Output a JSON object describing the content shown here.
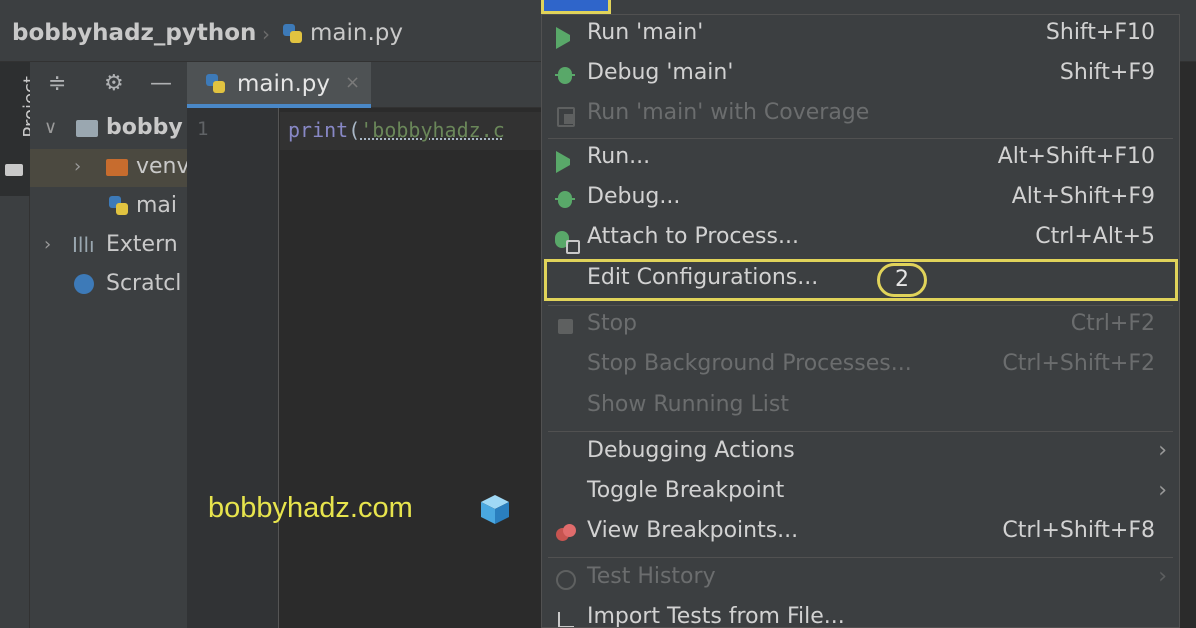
{
  "navbar": {
    "project_name": "bobbyhadz_python",
    "separator": "›",
    "file_name": "main.py"
  },
  "stripe": {
    "project_label": "Project"
  },
  "project_panel": {
    "toolbar_icons": [
      "collapse-icon",
      "gear-icon",
      "minimize-icon"
    ],
    "tree": [
      {
        "label": "bobby",
        "icon": "folder-icon",
        "arrow": "v"
      },
      {
        "label": "venv",
        "icon": "folder-orange-icon",
        "arrow": ">"
      },
      {
        "label": "mai",
        "icon": "python-file-icon"
      },
      {
        "label": "Extern",
        "icon": "library-icon",
        "arrow": ">"
      },
      {
        "label": "Scratcl",
        "icon": "scratch-icon"
      }
    ]
  },
  "editor": {
    "tab_label": "main.py",
    "tab_close": "×",
    "line_number": "1",
    "code_fn": "print",
    "code_open": "(",
    "code_str": "'bobbyhadz.c"
  },
  "watermark": "bobbyhadz.com",
  "menu": {
    "items": [
      {
        "label": "Run 'main'",
        "shortcut": "Shift+F10",
        "icon": "run-icon",
        "enabled": true
      },
      {
        "label": "Debug 'main'",
        "shortcut": "Shift+F9",
        "icon": "debug-icon",
        "enabled": true
      },
      {
        "label": "Run 'main' with Coverage",
        "shortcut": "",
        "icon": "coverage-icon",
        "enabled": false
      },
      {
        "label": "Run...",
        "shortcut": "Alt+Shift+F10",
        "icon": "run-icon",
        "enabled": true
      },
      {
        "label": "Debug...",
        "shortcut": "Alt+Shift+F9",
        "icon": "debug-icon",
        "enabled": true
      },
      {
        "label": "Attach to Process...",
        "shortcut": "Ctrl+Alt+5",
        "icon": "attach-icon",
        "enabled": true
      },
      {
        "label": "Edit Configurations...",
        "shortcut": "",
        "icon": "",
        "enabled": true
      },
      {
        "label": "Stop",
        "shortcut": "Ctrl+F2",
        "icon": "stop-icon",
        "enabled": false
      },
      {
        "label": "Stop Background Processes...",
        "shortcut": "Ctrl+Shift+F2",
        "icon": "",
        "enabled": false
      },
      {
        "label": "Show Running List",
        "shortcut": "",
        "icon": "",
        "enabled": false
      },
      {
        "label": "Debugging Actions",
        "shortcut": "",
        "icon": "",
        "enabled": true,
        "submenu": "›"
      },
      {
        "label": "Toggle Breakpoint",
        "shortcut": "",
        "icon": "",
        "enabled": true,
        "submenu": "›"
      },
      {
        "label": "View Breakpoints...",
        "shortcut": "Ctrl+Shift+F8",
        "icon": "breakpoints-icon",
        "enabled": true
      },
      {
        "label": "Test History",
        "shortcut": "",
        "icon": "history-icon",
        "enabled": false,
        "submenu": "›"
      },
      {
        "label": "Import Tests from File...",
        "shortcut": "",
        "icon": "import-icon",
        "enabled": true
      }
    ],
    "step_badge": "2"
  },
  "colors": {
    "highlight": "#e0d35a",
    "run_green": "#59a869",
    "accent_blue": "#4a88c7"
  }
}
